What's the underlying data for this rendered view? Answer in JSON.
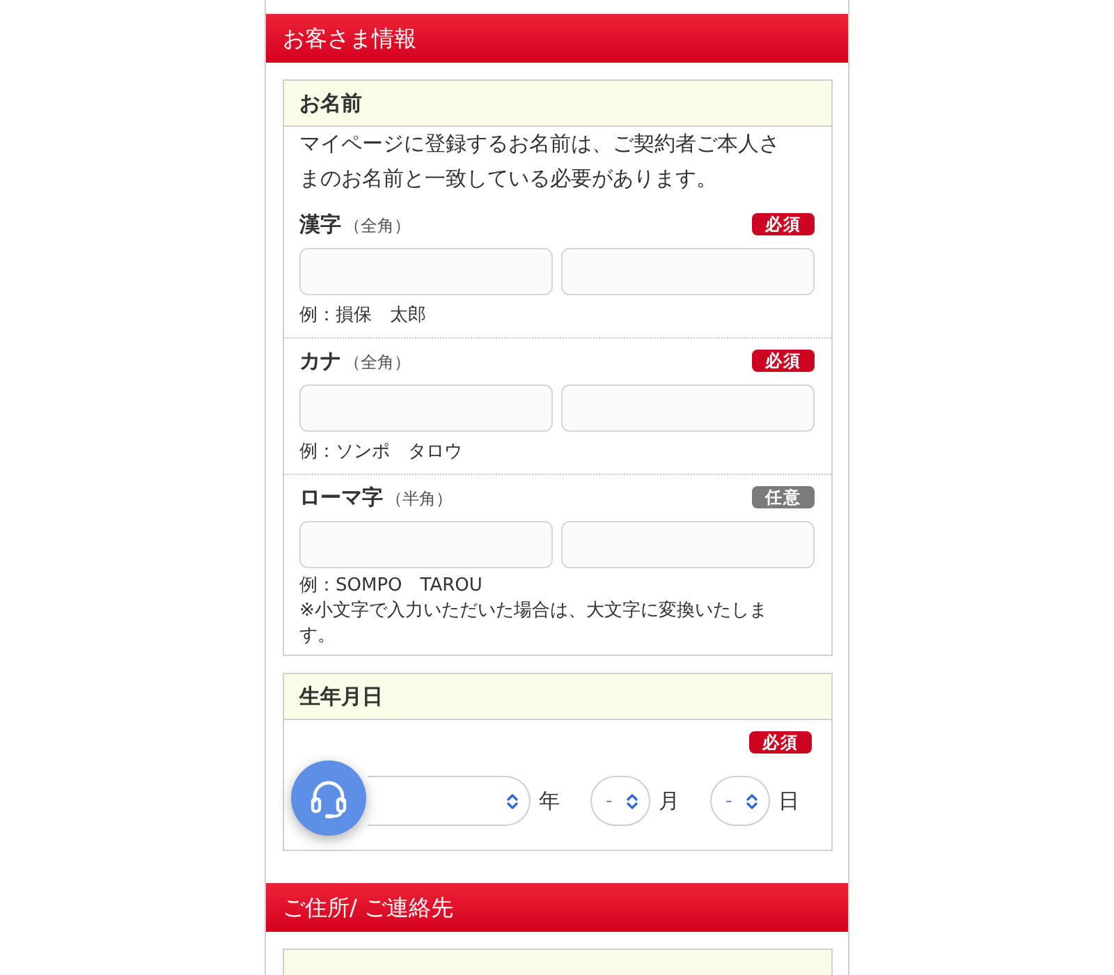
{
  "sections": [
    {
      "title": "お客さま情報",
      "panels": [
        {
          "kind": "name",
          "title": "お名前",
          "description": "マイページに登録するお名前は、ご契約者ご本人さまのお名前と一致している必要があります。",
          "fields": [
            {
              "label": "漢字",
              "hint": "（全角）",
              "required": true,
              "badge": "必須",
              "example": "例：損保　太郎"
            },
            {
              "label": "カナ",
              "hint": "（全角）",
              "required": true,
              "badge": "必須",
              "example": "例：ソンポ　タロウ"
            },
            {
              "label": "ローマ字",
              "hint": "（半角）",
              "required": false,
              "badge": "任意",
              "example": "例：SOMPO　TAROU",
              "note": "※小文字で入力いただいた場合は、大文字に変換いたします。"
            }
          ]
        },
        {
          "kind": "date",
          "title": "生年月日",
          "required": true,
          "badge": "必須",
          "selects": [
            {
              "unit": "年"
            },
            {
              "value": "-",
              "unit": "月"
            },
            {
              "value": "-",
              "unit": "日"
            }
          ]
        }
      ]
    },
    {
      "title": "ご住所/ ご連絡先",
      "panels": [
        {
          "kind": "address"
        }
      ]
    }
  ]
}
